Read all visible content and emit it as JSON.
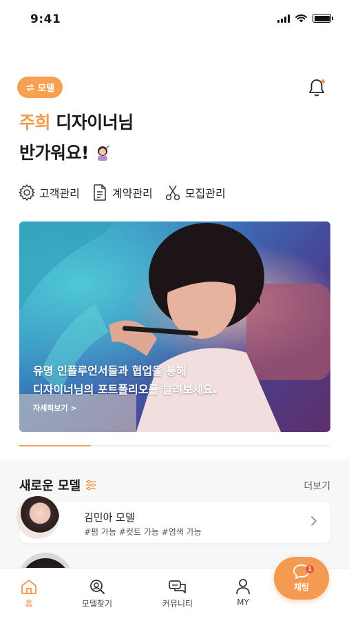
{
  "status_bar": {
    "time": "9:41"
  },
  "header": {
    "mode_badge": "모델",
    "greeting_name": "주희",
    "greeting_line1_rest": " 디자이너님",
    "greeting_line2": "반가워요!"
  },
  "menu": [
    {
      "label": "고객관리",
      "icon": "gear-icon"
    },
    {
      "label": "계약관리",
      "icon": "document-icon"
    },
    {
      "label": "모집관리",
      "icon": "scissors-icon"
    }
  ],
  "banner": {
    "line1": "유명 인플루언서들과 협업을 통해",
    "line2": "디자이너님의 포트폴리오를 늘려보세요.",
    "more": "자세히보기 >",
    "progress": 0.23
  },
  "new_models": {
    "title": "새로운 모델",
    "more": "더보기",
    "items": [
      {
        "name": "김민아 모델",
        "tags": "#펌 가능 #컷트 가능 #염색 가능"
      }
    ]
  },
  "tabbar": {
    "items": [
      {
        "label": "홈",
        "icon": "home-icon",
        "active": true
      },
      {
        "label": "모델찾기",
        "icon": "search-icon",
        "active": false
      },
      {
        "label": "커뮤니티",
        "icon": "chat-bubbles-icon",
        "active": false
      },
      {
        "label": "MY",
        "icon": "person-icon",
        "active": false
      }
    ]
  },
  "chat_fab": {
    "label": "채팅",
    "badge": "1"
  },
  "colors": {
    "accent": "#f49a52",
    "name_highlight": "#f29a4d",
    "badge_red": "#e8563a"
  }
}
